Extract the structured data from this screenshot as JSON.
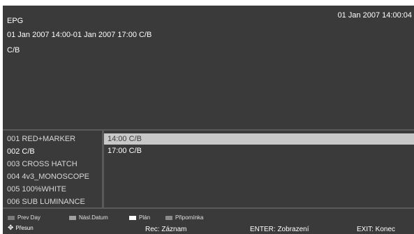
{
  "info": {
    "title": "EPG",
    "clock": "01 Jan 2007 14:00:04",
    "time_range": "01 Jan 2007 14:00-01 Jan 2007 17:00 C/B",
    "program_name": "C/B"
  },
  "channels": [
    "001 RED+MARKER",
    "002 C/B",
    "003 CROSS HATCH",
    "004 4v3_MONOSCOPE",
    "005 100%WHITE",
    "006 SUB LUMINANCE"
  ],
  "selected_channel_index": 1,
  "events": [
    "14:00 C/B",
    "17:00 C/B"
  ],
  "legend": {
    "prev_day": "Prev Day",
    "next_date": "Násl.Datum",
    "plan": "Plán",
    "reminder": "Připomínka",
    "move": "Přesun"
  },
  "hints": {
    "rec": "Rec: Záznam",
    "enter": "ENTER: Zobrazení",
    "exit": "EXIT: Konec"
  },
  "colors": {
    "background": "#3a3a3a",
    "highlight": "#c8c8c8",
    "prev_day_key": "#7a7a7a",
    "next_date_key": "#a0a0a0",
    "plan_key": "#ffffff",
    "reminder_key": "#8a8a8a"
  },
  "icons": {
    "move": "four-way-arrow-icon"
  }
}
